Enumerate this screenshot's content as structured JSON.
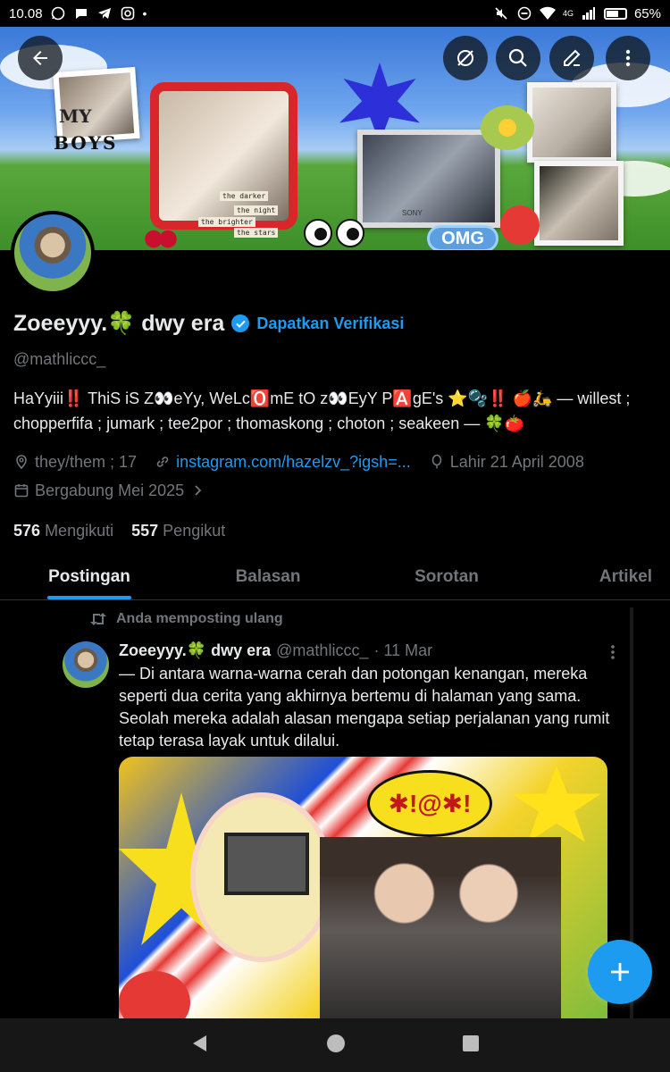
{
  "status_bar": {
    "time": "10.08",
    "network": "4G",
    "battery": "65%"
  },
  "banner": {
    "text_my": "MY",
    "text_boys": "BOYS",
    "caption_1": "the darker",
    "caption_2": "the night",
    "caption_3": "the brighter",
    "caption_4": "the stars",
    "camera_brand": "SONY",
    "omg": "OMG"
  },
  "profile": {
    "name": "Zoeeyyy.🍀 dwy era",
    "verify_cta": "Dapatkan Verifikasi",
    "handle": "@mathliccc_",
    "bio": "HaYyiii‼️ ThiS iS Z👀eYy, WeLc🅾️mE tO z👀EyY P🅰️gE's ⭐🫧‼️  🍎🛵 — willest ; chopperfifa ; jumark ; tee2por ; thomaskong ; choton ;  seakeen — 🍀🍅",
    "pronouns": "they/them ; 17",
    "website": "instagram.com/hazelzv_?igsh=...",
    "birth": "Lahir 21 April 2008",
    "joined": "Bergabung Mei 2025",
    "following_count": "576",
    "following_label": "Mengikuti",
    "followers_count": "557",
    "followers_label": "Pengikut"
  },
  "tabs": [
    "Postingan",
    "Balasan",
    "Sorotan",
    "Artikel"
  ],
  "post": {
    "repost_label": "Anda memposting ulang",
    "author_name": "Zoeeyyy.🍀 dwy era",
    "author_handle": "@mathliccc_",
    "date": "· 11 Mar",
    "text": "— Di antara warna-warna cerah dan potongan kenangan, mereka seperti dua cerita yang akhirnya bertemu di halaman yang sama. Seolah mereka adalah alasan mengapa setiap perjalanan yang rumit tetap terasa layak untuk dilalui.",
    "media_bubble": "✱!@✱!"
  },
  "colors": {
    "accent": "#1d9bf0",
    "muted": "#71767b",
    "text": "#e7e9ea",
    "background": "#000000"
  },
  "icons": [
    "back-arrow-icon",
    "spaces-icon",
    "search-icon",
    "edit-icon",
    "more-icon",
    "location-icon",
    "link-icon",
    "balloon-icon",
    "calendar-icon",
    "chevron-right-icon",
    "repost-icon",
    "plus-icon",
    "nav-back-icon",
    "nav-home-icon",
    "nav-recents-icon"
  ]
}
